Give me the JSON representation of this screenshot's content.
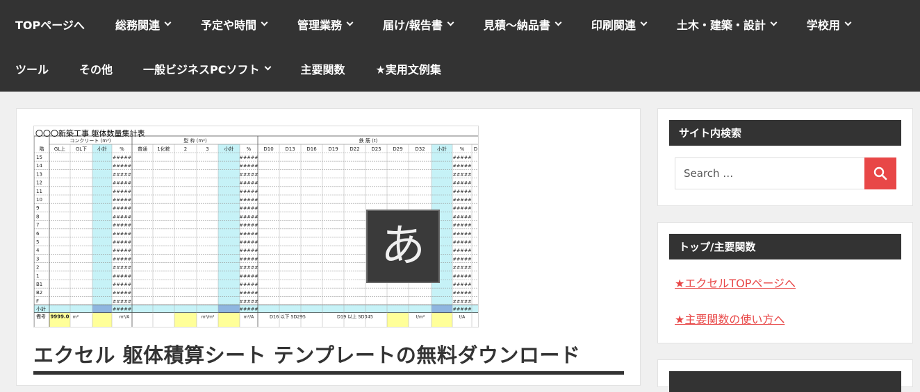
{
  "nav": {
    "row1": [
      {
        "label": "TOPページへ",
        "dropdown": false
      },
      {
        "label": "総務関連",
        "dropdown": true
      },
      {
        "label": "予定や時間",
        "dropdown": true
      },
      {
        "label": "管理業務",
        "dropdown": true
      },
      {
        "label": "届け/報告書",
        "dropdown": true
      },
      {
        "label": "見積～納品書",
        "dropdown": true
      },
      {
        "label": "印刷関連",
        "dropdown": true
      },
      {
        "label": "土木・建築・設計",
        "dropdown": true
      },
      {
        "label": "学校用",
        "dropdown": true
      }
    ],
    "row2": [
      {
        "label": "ツール",
        "dropdown": false
      },
      {
        "label": "その他",
        "dropdown": false
      },
      {
        "label": "一般ビジネスPCソフト",
        "dropdown": true
      },
      {
        "label": "主要関数",
        "dropdown": false
      },
      {
        "label": "★実用文例集",
        "dropdown": false
      }
    ]
  },
  "post": {
    "title": "エクセル 躯体積算シート テンプレートの無料ダウンロード",
    "thumbnail": {
      "sheet_title": "〇〇〇新築工事 躯体数量集計表",
      "group_headers": [
        "コンクリート (m³)",
        "型 枠 (m²)",
        "鉄 筋 (t)"
      ],
      "column_headers": [
        "階",
        "GL上",
        "GL下",
        "小計",
        "%",
        "普通",
        "1化粧",
        "2",
        "3",
        "小計",
        "%",
        "D10",
        "D13",
        "D16",
        "D19",
        "D22",
        "D25",
        "D29",
        "D32",
        "小計",
        "%",
        "D"
      ],
      "floors": [
        "15",
        "14",
        "13",
        "12",
        "11",
        "10",
        "9",
        "8",
        "7",
        "6",
        "5",
        "4",
        "3",
        "2",
        "1",
        "B1",
        "B2",
        "F"
      ],
      "overflow_text": "#####",
      "subtotal_label": "小計",
      "remarks_label": "備考",
      "remarks_value": "9999.0",
      "remarks_units": [
        "m²",
        "m²/A",
        "m²/m²",
        "m²/A",
        "t/m²",
        "t/A"
      ],
      "rebar_notes": [
        "D16 以下 SD295",
        "D19 以上 SD345"
      ],
      "ime_glyph": "あ"
    }
  },
  "sidebar": {
    "search": {
      "title": "サイト内検索",
      "placeholder": "Search …",
      "button_icon": "search-icon"
    },
    "top_functions": {
      "title": "トップ/主要関数",
      "links": [
        "★エクセルTOPページへ",
        "★主要関数の使い方へ"
      ]
    }
  },
  "colors": {
    "nav_bg": "#333333",
    "accent": "#e84747",
    "widget_title_bg": "#333333",
    "highlight_col": "#c6f2f7",
    "highlight_yellow": "#ffff99"
  }
}
